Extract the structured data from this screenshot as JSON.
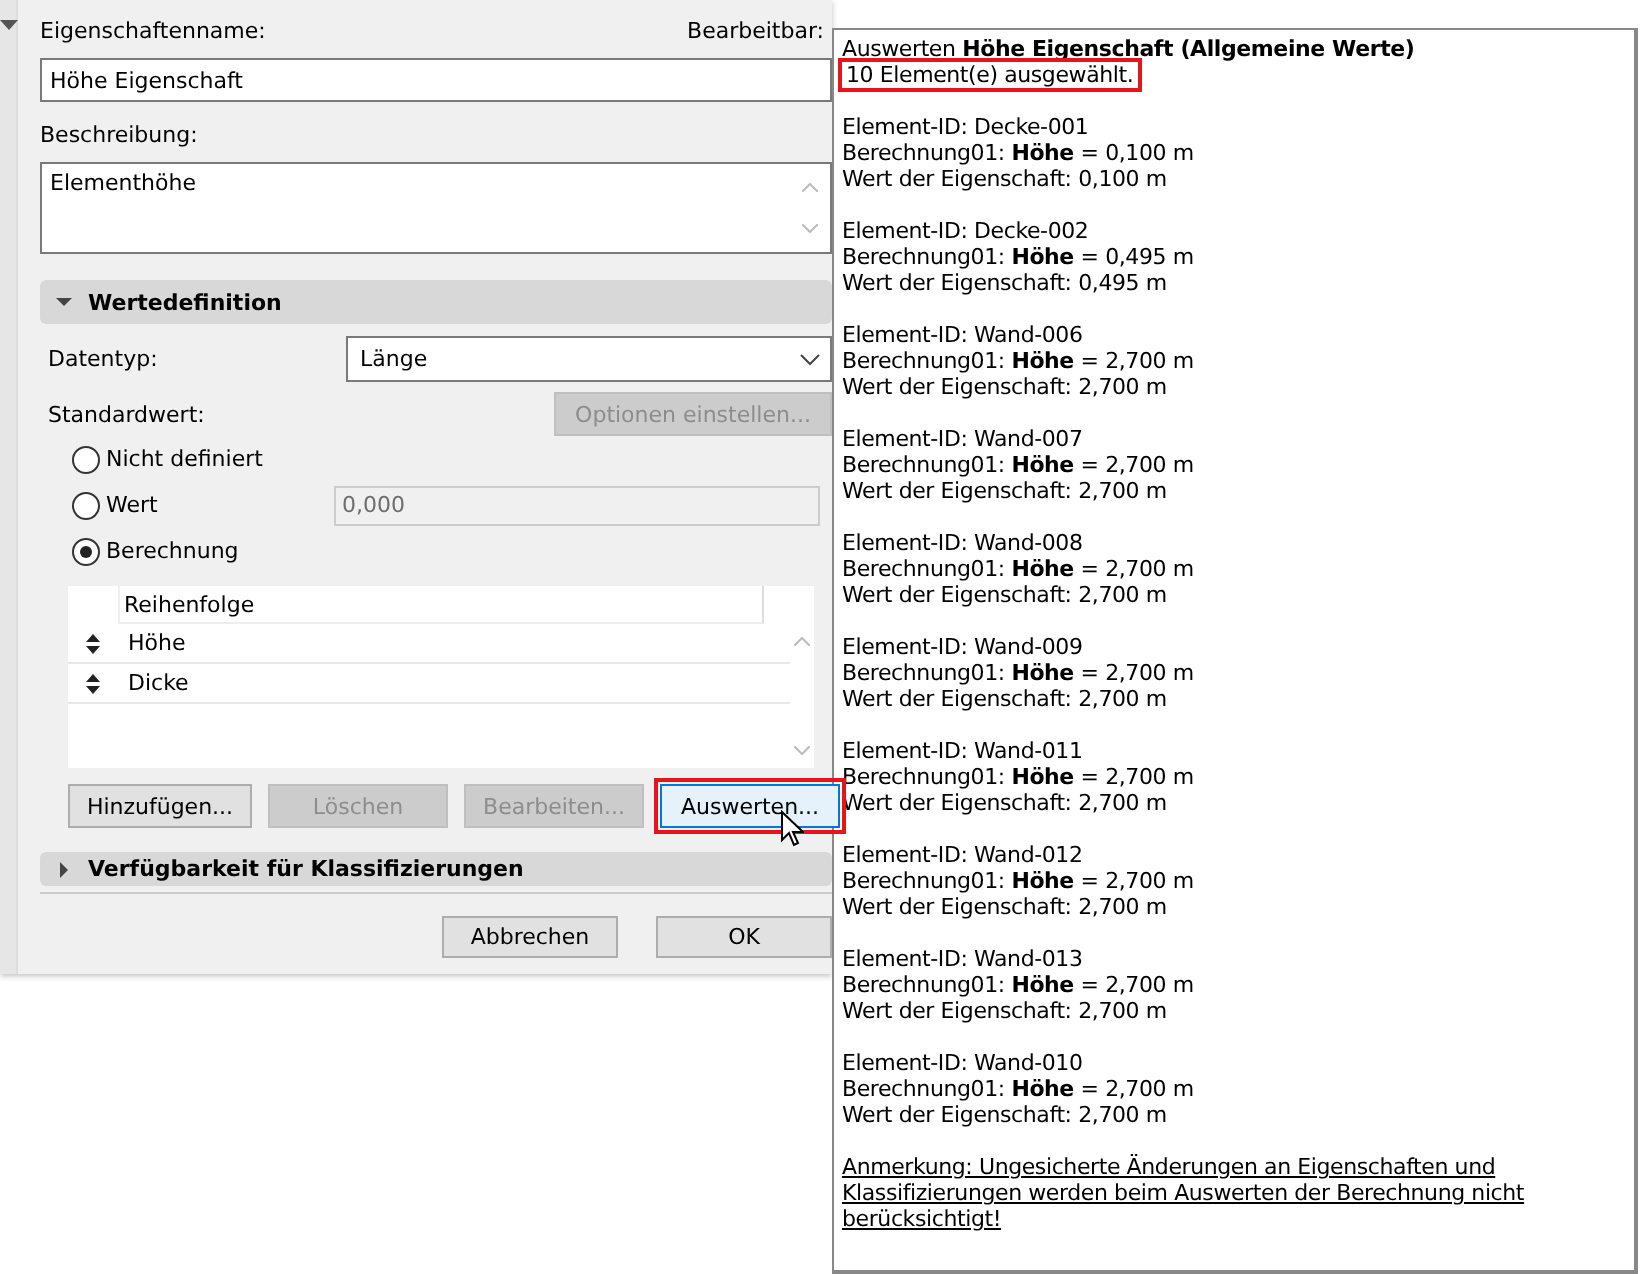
{
  "dialog": {
    "name_label": "Eigenschaftenname:",
    "editable_label": "Bearbeitbar:",
    "name_value": "Höhe Eigenschaft",
    "description_label": "Beschreibung:",
    "description_value": "Elementhöhe",
    "value_section": {
      "title": "Wertedefinition",
      "expanded": true,
      "datatype_label": "Datentyp:",
      "datatype_value": "Länge",
      "default_label": "Standardwert:",
      "options_button": {
        "label": "Optionen einstellen...",
        "disabled": true
      },
      "radios": [
        {
          "label": "Nicht definiert",
          "selected": false
        },
        {
          "label": "Wert",
          "selected": false,
          "value": "0,000"
        },
        {
          "label": "Berechnung",
          "selected": true
        }
      ],
      "order_header": "Reihenfolge",
      "order_rows": [
        "Höhe",
        "Dicke"
      ],
      "buttons": [
        {
          "label": "Hinzufügen...",
          "disabled": false,
          "highlighted": false
        },
        {
          "label": "Löschen",
          "disabled": true,
          "highlighted": false
        },
        {
          "label": "Bearbeiten...",
          "disabled": true,
          "highlighted": false
        },
        {
          "label": "Auswerten...",
          "disabled": false,
          "highlighted": true
        }
      ]
    },
    "class_section": {
      "title": "Verfügbarkeit für Klassifizierungen",
      "expanded": false
    },
    "footer_buttons": [
      "Abbrechen",
      "OK"
    ]
  },
  "result": {
    "title": "Auswerten **Höhe Eigenschaft (Allgemeine Werte)**",
    "count": "10 Element(e) ausgewählt.",
    "count_highlighted": true,
    "entries": [
      {
        "id": "Element-ID: Decke-001",
        "calc": "Berechnung01: **Höhe** = 0,100 m",
        "value": "Wert der Eigenschaft: 0,100 m"
      },
      {
        "id": "Element-ID: Decke-002",
        "calc": "Berechnung01: **Höhe** = 0,495 m",
        "value": "Wert der Eigenschaft: 0,495 m"
      },
      {
        "id": "Element-ID: Wand-006",
        "calc": "Berechnung01: **Höhe** = 2,700 m",
        "value": "Wert der Eigenschaft: 2,700 m"
      },
      {
        "id": "Element-ID: Wand-007",
        "calc": "Berechnung01: **Höhe** = 2,700 m",
        "value": "Wert der Eigenschaft: 2,700 m"
      },
      {
        "id": "Element-ID: Wand-008",
        "calc": "Berechnung01: **Höhe** = 2,700 m",
        "value": "Wert der Eigenschaft: 2,700 m"
      },
      {
        "id": "Element-ID: Wand-009",
        "calc": "Berechnung01: **Höhe** = 2,700 m",
        "value": "Wert der Eigenschaft: 2,700 m"
      },
      {
        "id": "Element-ID: Wand-011",
        "calc": "Berechnung01: **Höhe** = 2,700 m",
        "value": "Wert der Eigenschaft: 2,700 m"
      },
      {
        "id": "Element-ID: Wand-012",
        "calc": "Berechnung01: **Höhe** = 2,700 m",
        "value": "Wert der Eigenschaft: 2,700 m"
      },
      {
        "id": "Element-ID: Wand-013",
        "calc": "Berechnung01: **Höhe** = 2,700 m",
        "value": "Wert der Eigenschaft: 2,700 m"
      },
      {
        "id": "Element-ID: Wand-010",
        "calc": "Berechnung01: **Höhe** = 2,700 m",
        "value": "Wert der Eigenschaft: 2,700 m"
      }
    ],
    "note": "Anmerkung: Ungesicherte Änderungen an Eigenschaften und Klassifizierungen werden beim Auswerten der Berechnung nicht berücksichtigt!"
  }
}
